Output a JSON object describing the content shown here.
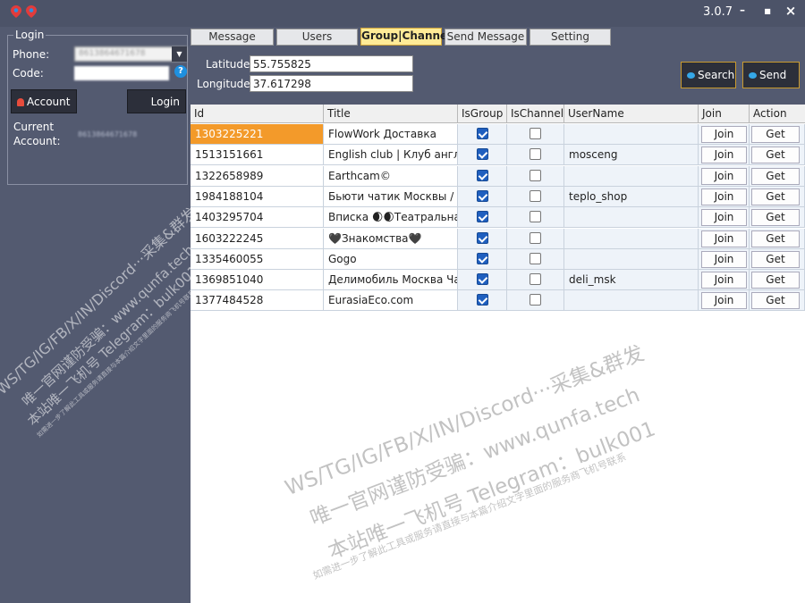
{
  "app": {
    "version": "3.0.7"
  },
  "window_controls": {
    "minimize": "–",
    "maximize": "■",
    "close": "×"
  },
  "login": {
    "legend": "Login",
    "phone_label": "Phone:",
    "phone_value": "8613864671678",
    "code_label": "Code:",
    "help": "?",
    "account_btn": "Account",
    "login_btn": "Login",
    "current_label": "Current Account:",
    "current_value": "8613864671678"
  },
  "tabs": [
    "Message",
    "Users",
    "Group|Channel",
    "Send Message",
    "Setting"
  ],
  "active_tab": "Group|Channel",
  "search_form": {
    "latitude_label": "Latitude:",
    "latitude": "55.755825",
    "longitude_label": "Longitude:",
    "longitude": "37.617298",
    "search_btn": "Search",
    "send_btn": "Send"
  },
  "table": {
    "headers": [
      "Id",
      "Title",
      "IsGroup",
      "IsChannel",
      "UserName",
      "Join",
      "Action"
    ],
    "join_label": "Join",
    "get_label": "Get",
    "rows": [
      {
        "id": "1303225221",
        "title": "FlowWork Доставка",
        "is_group": true,
        "is_channel": false,
        "username": ""
      },
      {
        "id": "1513151661",
        "title": "English club | Клуб англи...",
        "is_group": true,
        "is_channel": false,
        "username": "mosceng"
      },
      {
        "id": "1322658989",
        "title": "Earthcam©",
        "is_group": true,
        "is_channel": false,
        "username": ""
      },
      {
        "id": "1984188104",
        "title": "Бьюти чатик Москвы / Б...",
        "is_group": true,
        "is_channel": false,
        "username": "teplo_shop"
      },
      {
        "id": "1403295704",
        "title": "Вписка 🌒🌒Театральная",
        "is_group": true,
        "is_channel": false,
        "username": ""
      },
      {
        "id": "1603222245",
        "title": "🖤Знакомства🖤",
        "is_group": true,
        "is_channel": false,
        "username": ""
      },
      {
        "id": "1335460055",
        "title": "Gogo",
        "is_group": true,
        "is_channel": false,
        "username": ""
      },
      {
        "id": "1369851040",
        "title": "Делимобиль Москва Чат",
        "is_group": true,
        "is_channel": false,
        "username": "deli_msk"
      },
      {
        "id": "1377484528",
        "title": "EurasiaEco.com",
        "is_group": true,
        "is_channel": false,
        "username": ""
      }
    ]
  },
  "watermark": {
    "line1": "WS/TG/IG/FB/X/IN/Discord···采集&群发",
    "line2": "唯一官网谨防受骗：www.qunfa.tech",
    "line3": "本站唯一飞机号 Telegram：bulk001",
    "line4": "如需进一步了解此工具或服务请直接与本篇介绍文字里面的服务商飞机号联系"
  }
}
